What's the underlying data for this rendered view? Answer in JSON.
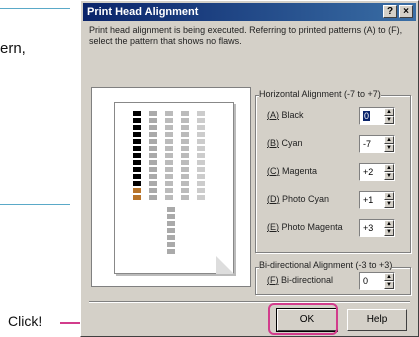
{
  "page": {
    "text_fragment": "ern,",
    "callout_label": "Click!"
  },
  "dialog": {
    "title": "Print Head Alignment",
    "title_buttons": [
      "?",
      "×"
    ],
    "instructions": "Print head alignment is being executed. Referring to printed patterns (A) to (F), select the pattern that shows no flaws.",
    "horizontal_group_label": "Horizontal Alignment (-7 to +7)",
    "horizontal_rows": [
      {
        "label": "Black",
        "key": "A",
        "value": "0"
      },
      {
        "label": "Cyan",
        "key": "B",
        "value": "-7"
      },
      {
        "label": "Magenta",
        "key": "C",
        "value": "+2"
      },
      {
        "label": "Photo Cyan",
        "key": "D",
        "value": "+1"
      },
      {
        "label": "Photo Magenta",
        "key": "E",
        "value": "+3"
      }
    ],
    "bidirectional_group_label": "Bi-directional Alignment (-3 to +3)",
    "bidirectional_rows": [
      {
        "label": "Bi-directional",
        "key": "F",
        "value": "0"
      }
    ],
    "ok_label": "OK",
    "help_label": "Help"
  },
  "colors": {
    "accent_rule": "#5aa9c8",
    "callout": "#d23c8c",
    "titlebar_start": "#0a246a",
    "titlebar_end": "#3a6ea5",
    "dialog_face": "#d4d0c8"
  }
}
